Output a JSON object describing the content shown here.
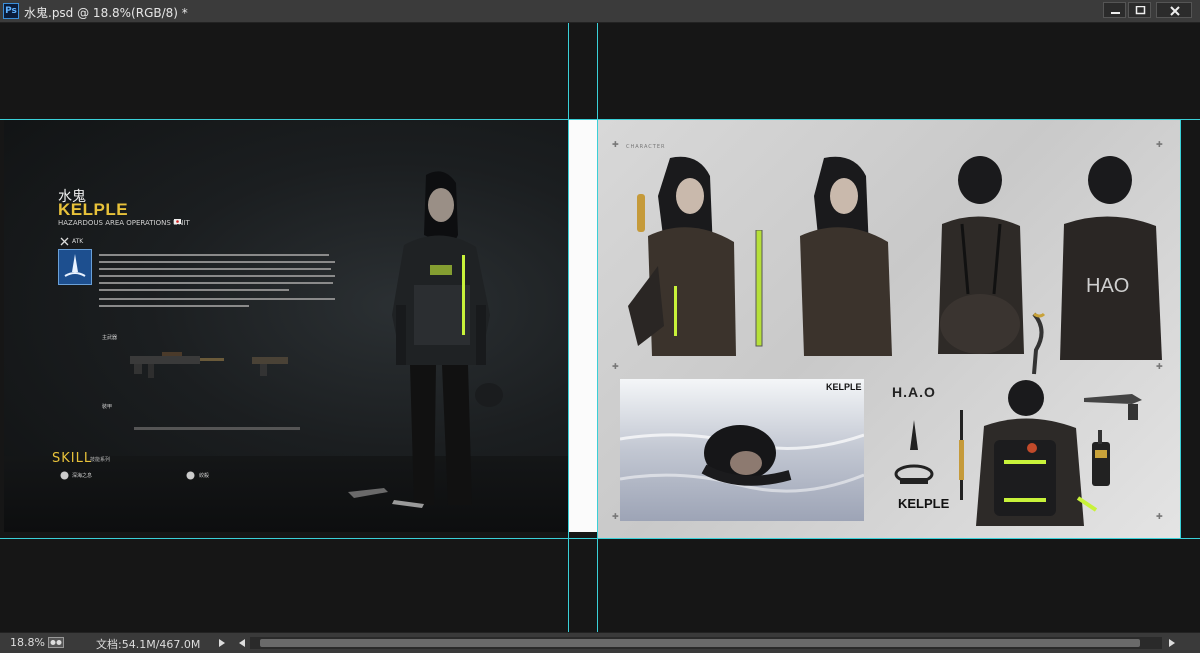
{
  "window": {
    "app_badge": "Ps",
    "title": "水鬼.psd @ 18.8%(RGB/8) *"
  },
  "left_panel": {
    "name_cn": "水鬼",
    "name_en": "KELPLE",
    "unit": "HAZARDOUS AREA OPERATIONS UNIT",
    "class_label": "ATK",
    "main_weapon_label": "主武器",
    "gear_label": "裝甲",
    "skill_title": "SKILL",
    "skill_subtitle": "技能系列",
    "skill_1": "深海之息",
    "skill_2": "絞殺"
  },
  "right_panel": {
    "section_label": "CHARACTER",
    "logo_kelple_small": "KELPLE",
    "logo_hao": "H.A.O",
    "logo_kelple_large": "KELPLE",
    "jacket_text": "HAO"
  },
  "status": {
    "zoom": "18.8%",
    "doc_info": "文档:54.1M/467.0M"
  },
  "colors": {
    "accent_yellow": "#e8c23a",
    "guide_cyan": "#3ad0d8",
    "neon_green": "#c8f23a"
  }
}
